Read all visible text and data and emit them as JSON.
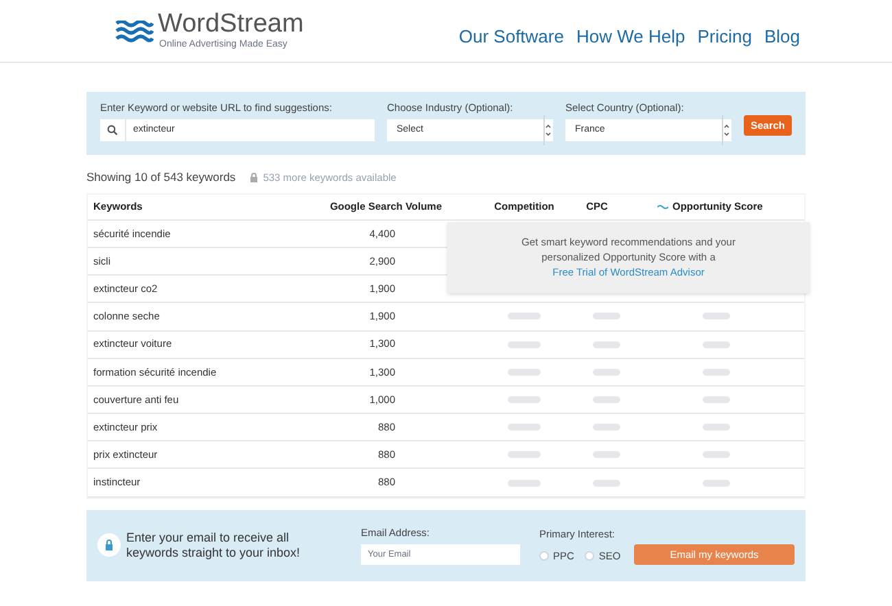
{
  "header": {
    "logo": {
      "name": "WordStream",
      "tagline": "Online Advertising Made Easy"
    },
    "nav": [
      "Our Software",
      "How We Help",
      "Pricing",
      "Blog"
    ]
  },
  "search": {
    "keyword_label": "Enter Keyword or website URL to find suggestions:",
    "keyword_value": "extincteur",
    "industry_label": "Choose Industry (Optional):",
    "industry_value": "Select",
    "country_label": "Select Country (Optional):",
    "country_value": "France",
    "button": "Search"
  },
  "summary": {
    "showing": "Showing 10 of 543 keywords",
    "more": "533 more keywords available"
  },
  "table": {
    "columns": [
      "Keywords",
      "Google Search Volume",
      "Competition",
      "CPC",
      "Opportunity Score"
    ],
    "rows": [
      {
        "keyword": "sécurité incendie",
        "volume": "4,400"
      },
      {
        "keyword": "sicli",
        "volume": "2,900"
      },
      {
        "keyword": "extincteur co2",
        "volume": "1,900"
      },
      {
        "keyword": "colonne seche",
        "volume": "1,900"
      },
      {
        "keyword": "extincteur voiture",
        "volume": "1,300"
      },
      {
        "keyword": "formation sécurité incendie",
        "volume": "1,300"
      },
      {
        "keyword": "couverture anti feu",
        "volume": "1,000"
      },
      {
        "keyword": "extincteur prix",
        "volume": "880"
      },
      {
        "keyword": "prix extincteur",
        "volume": "880"
      },
      {
        "keyword": "instincteur",
        "volume": "880"
      }
    ],
    "upsell": {
      "text": "Get smart keyword recommendations and your personalized Opportunity Score with a",
      "link": "Free Trial of WordStream Advisor"
    }
  },
  "email": {
    "message": "Enter your email to receive all keywords straight to your inbox!",
    "email_label": "Email Address:",
    "email_placeholder": "Your Email",
    "interest_label": "Primary Interest:",
    "options": [
      {
        "label": "PPC",
        "selected": false
      },
      {
        "label": "SEO",
        "selected": false
      }
    ],
    "button": "Email my keywords"
  }
}
